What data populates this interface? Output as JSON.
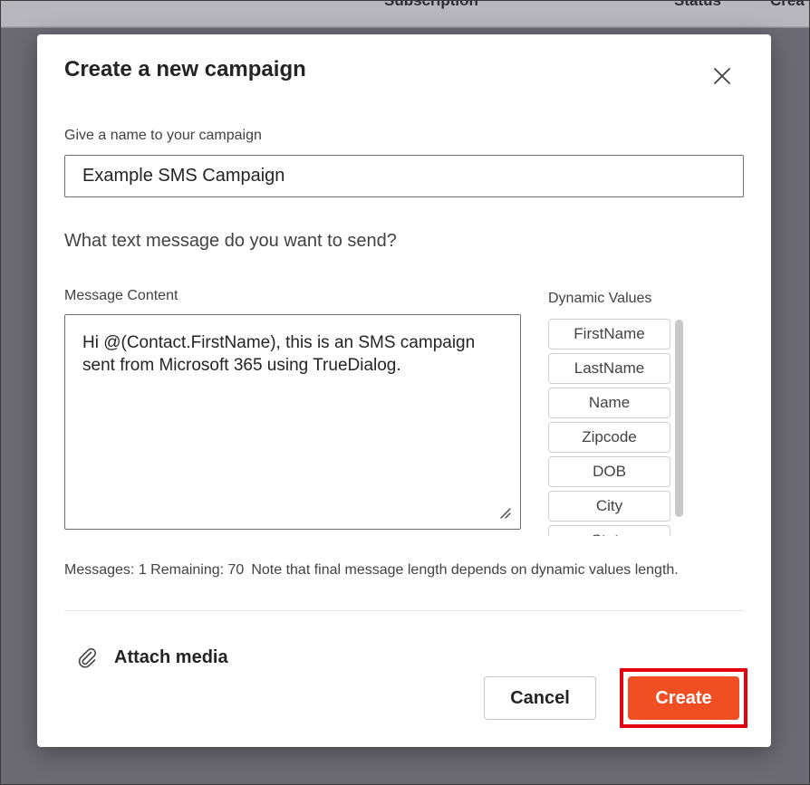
{
  "background": {
    "columns": [
      "Subscription",
      "Status",
      "Crea"
    ]
  },
  "dialog": {
    "title": "Create a new campaign",
    "close_icon": "close-icon",
    "name_label": "Give a name to your campaign",
    "name_value": "Example SMS Campaign",
    "question": "What text message do you want to send?",
    "message_label": "Message Content",
    "message_value": "Hi @(Contact.FirstName), this is an SMS campaign sent from Microsoft 365 using TrueDialog.",
    "dynamic_label": "Dynamic Values",
    "dynamic_values": [
      "FirstName",
      "LastName",
      "Name",
      "Zipcode",
      "DOB",
      "City",
      "State"
    ],
    "counter": "Messages: 1 Remaining: 70",
    "note": "Note that final message length depends on dynamic values length.",
    "attach_label": "Attach media",
    "attach_icon": "paperclip-icon",
    "cancel_label": "Cancel",
    "create_label": "Create",
    "colors": {
      "accent": "#f04e23",
      "highlight": "#e3000f"
    }
  }
}
